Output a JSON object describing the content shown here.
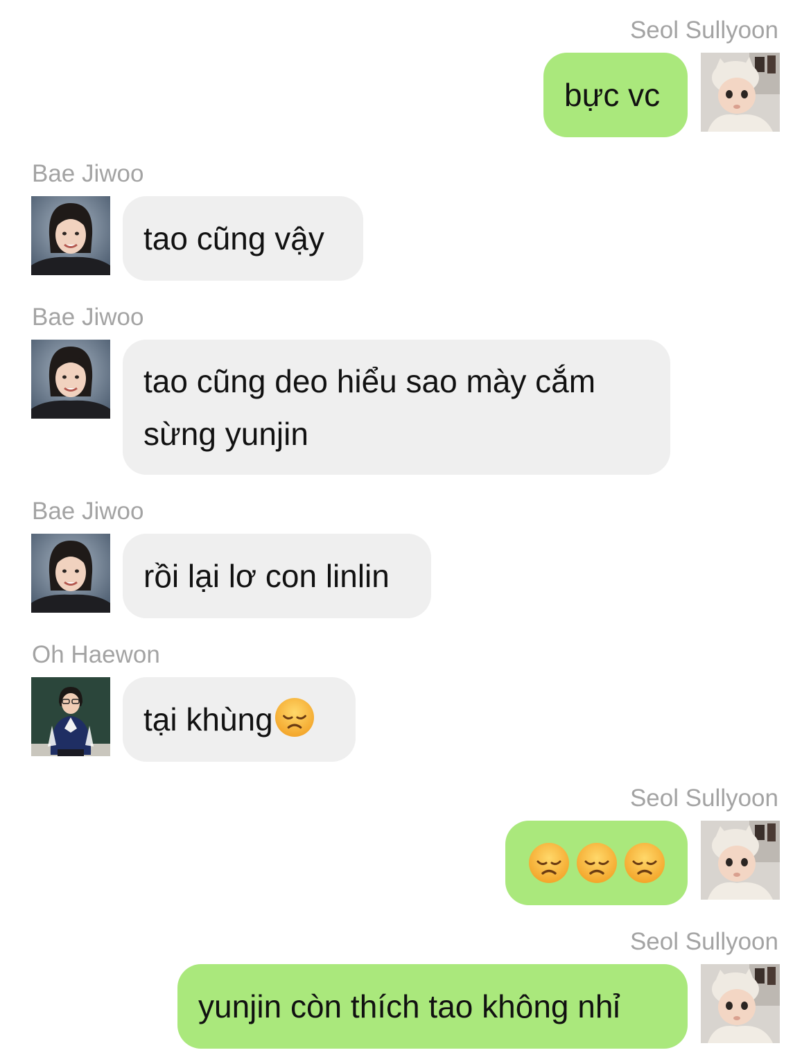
{
  "messages": [
    {
      "sender": "Seol Sullyoon",
      "side": "right",
      "text": "bực vc"
    },
    {
      "sender": "Bae Jiwoo",
      "side": "left",
      "text": "tao cũng vậy"
    },
    {
      "sender": "Bae Jiwoo",
      "side": "left",
      "line1": "tao cũng deo hiểu sao mày cắm",
      "line2": "sừng yunjin"
    },
    {
      "sender": "Bae Jiwoo",
      "side": "left",
      "text": "rồi lại lơ con linlin"
    },
    {
      "sender": "Oh Haewon",
      "side": "left",
      "text": "tại khùng",
      "emoji": "disappointed-face"
    },
    {
      "sender": "Seol Sullyoon",
      "side": "right",
      "emoji": "disappointed-face",
      "emoji_count": 3
    },
    {
      "sender": "Seol Sullyoon",
      "side": "right",
      "text": "yunjin còn thích tao không nhỉ"
    }
  ],
  "colors": {
    "outgoing_bubble": "#aae87c",
    "incoming_bubble": "#efefef",
    "sender_name": "#a3a3a3"
  },
  "avatars": {
    "seol_sullyoon": "baby-photo-avatar",
    "bae_jiwoo": "girl-portrait-avatar",
    "oh_haewon": "child-chalkboard-avatar"
  }
}
